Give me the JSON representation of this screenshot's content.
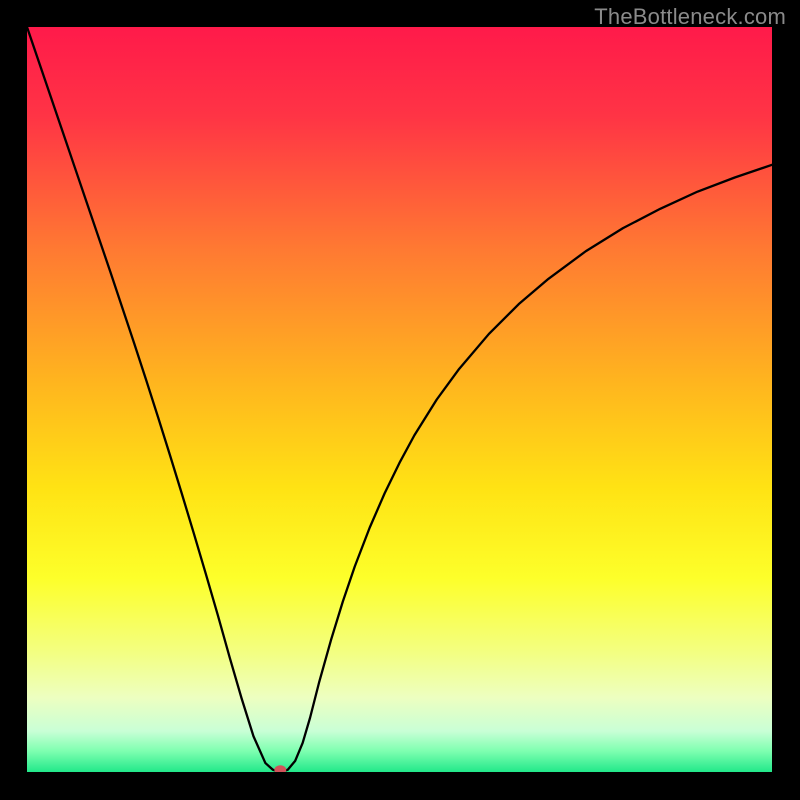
{
  "watermark": "TheBottleneck.com",
  "chart_data": {
    "type": "line",
    "title": "",
    "xlabel": "",
    "ylabel": "",
    "xlim": [
      0,
      100
    ],
    "ylim": [
      0,
      100
    ],
    "background_gradient": {
      "stops": [
        {
          "offset": 0.0,
          "color": "#ff1a4a"
        },
        {
          "offset": 0.12,
          "color": "#ff3445"
        },
        {
          "offset": 0.3,
          "color": "#ff7a32"
        },
        {
          "offset": 0.48,
          "color": "#ffb61e"
        },
        {
          "offset": 0.62,
          "color": "#ffe314"
        },
        {
          "offset": 0.74,
          "color": "#fdff2a"
        },
        {
          "offset": 0.84,
          "color": "#f3ff82"
        },
        {
          "offset": 0.9,
          "color": "#edffc0"
        },
        {
          "offset": 0.945,
          "color": "#c9ffd6"
        },
        {
          "offset": 0.972,
          "color": "#7effb0"
        },
        {
          "offset": 1.0,
          "color": "#22e88a"
        }
      ]
    },
    "series": [
      {
        "name": "bottleneck-curve",
        "x": [
          0.0,
          1.6,
          3.2,
          4.8,
          6.4,
          8.0,
          9.6,
          11.2,
          12.8,
          14.4,
          16.0,
          17.6,
          19.2,
          20.8,
          22.4,
          24.0,
          25.6,
          27.2,
          28.8,
          30.4,
          32.0,
          33.0,
          34.0,
          35.0,
          36.0,
          37.0,
          38.0,
          39.2,
          40.8,
          42.4,
          44.0,
          46.0,
          48.0,
          50.0,
          52.0,
          55.0,
          58.0,
          62.0,
          66.0,
          70.0,
          75.0,
          80.0,
          85.0,
          90.0,
          95.0,
          100.0
        ],
        "y": [
          100.0,
          95.3,
          90.6,
          85.9,
          81.2,
          76.5,
          71.8,
          67.1,
          62.3,
          57.5,
          52.6,
          47.6,
          42.5,
          37.3,
          32.0,
          26.6,
          21.1,
          15.4,
          9.9,
          4.8,
          1.2,
          0.3,
          0.0,
          0.3,
          1.5,
          3.9,
          7.3,
          12.0,
          17.7,
          22.9,
          27.6,
          32.8,
          37.4,
          41.5,
          45.2,
          50.0,
          54.1,
          58.8,
          62.8,
          66.2,
          69.9,
          73.0,
          75.6,
          77.9,
          79.8,
          81.5
        ]
      }
    ],
    "marker": {
      "x": 34.0,
      "y": 0.3,
      "color": "#d2535a",
      "rx": 6,
      "ry": 4.5
    }
  }
}
